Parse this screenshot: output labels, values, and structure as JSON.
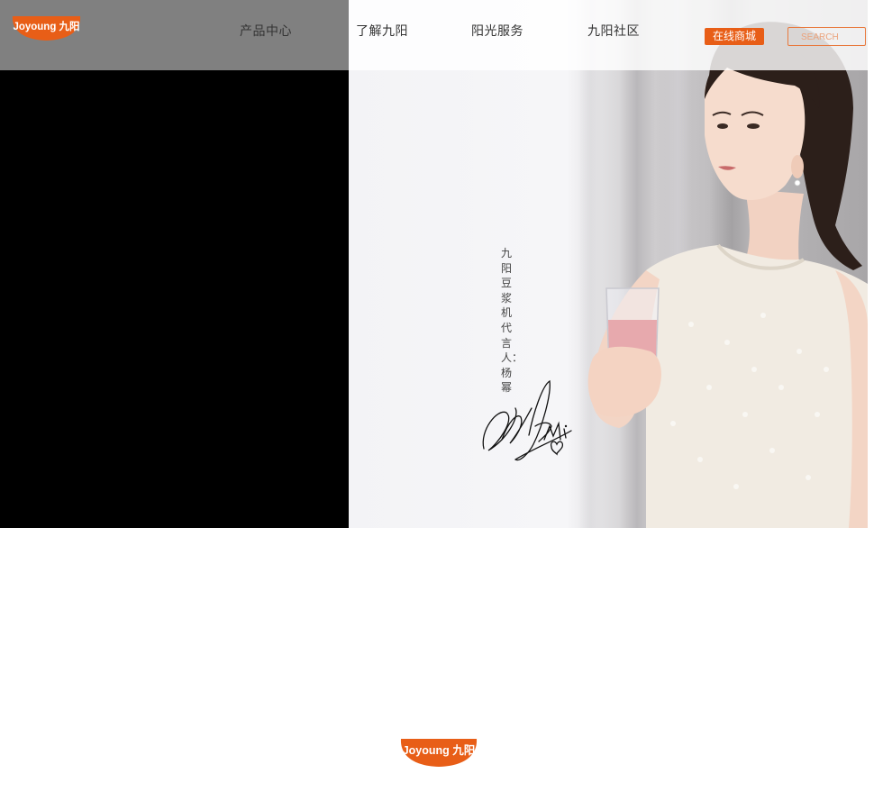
{
  "brand": {
    "logo_text": "Joyoung 九阳",
    "color_orange": "#e85e17"
  },
  "nav": {
    "items": [
      {
        "label": "产品中心"
      },
      {
        "label": "了解九阳"
      },
      {
        "label": "阳光服务"
      },
      {
        "label": "九阳社区"
      }
    ],
    "shop_label": "在线商城",
    "search_placeholder": "SEARCH"
  },
  "hero": {
    "caption": "九阳豆浆机代言人：杨幂",
    "signature_icon": "signature-mi"
  }
}
